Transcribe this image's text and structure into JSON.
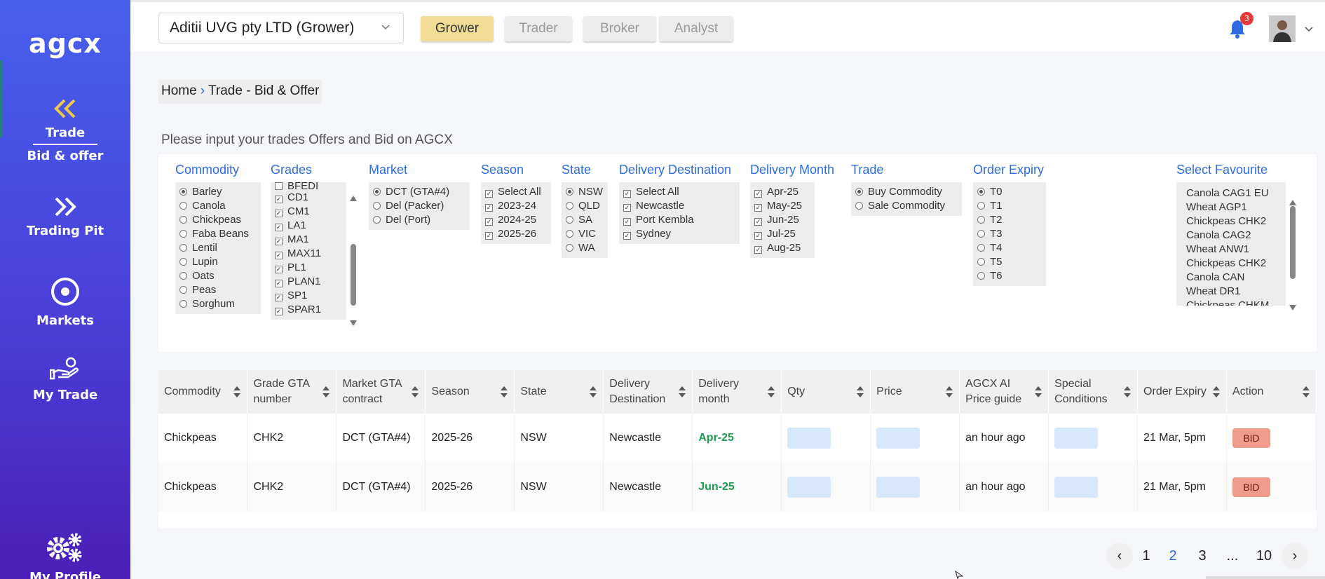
{
  "sidebar": {
    "logo": "agcx",
    "items": [
      {
        "label": "Trade",
        "sublabel": "Bid & offer",
        "icon": "double-chevron-left-icon"
      },
      {
        "label": "Trading Pit",
        "icon": "double-chevron-right-icon"
      },
      {
        "label": "Markets",
        "icon": "target-icon"
      },
      {
        "label": "My Trade",
        "icon": "hand-coin-icon"
      },
      {
        "label": "My Profile",
        "icon": "gears-icon"
      }
    ]
  },
  "header": {
    "company": "Aditii UVG pty LTD (Grower)",
    "roles": [
      "Grower",
      "Trader",
      "Broker",
      "Analyst"
    ],
    "active_role": "Grower",
    "notification_count": "3"
  },
  "breadcrumb": {
    "home": "Home",
    "current": "Trade - Bid & Offer"
  },
  "intro": "Please input your trades Offers and Bid on AGCX",
  "filters": {
    "commodity": {
      "title": "Commodity",
      "options": [
        "Barley",
        "Canola",
        "Chickpeas",
        "Faba Beans",
        "Lentil",
        "Lupin",
        "Oats",
        "Peas",
        "Sorghum"
      ],
      "selected": "Barley"
    },
    "grades": {
      "title": "Grades",
      "partial": "BFEDI",
      "options": [
        "CD1",
        "CM1",
        "LA1",
        "MA1",
        "MAX11",
        "PL1",
        "PLAN1",
        "SP1",
        "SPAR1"
      ]
    },
    "market": {
      "title": "Market",
      "options": [
        "DCT (GTA#4)",
        "Del (Packer)",
        "Del (Port)"
      ],
      "selected": "DCT (GTA#4)"
    },
    "season": {
      "title": "Season",
      "options": [
        "Select All",
        "2023-24",
        "2024-25",
        "2025-26"
      ]
    },
    "state": {
      "title": "State",
      "options": [
        "NSW",
        "QLD",
        "SA",
        "VIC",
        "WA"
      ],
      "selected": "NSW"
    },
    "delivery_destination": {
      "title": "Delivery Destination",
      "options": [
        "Select All",
        "Newcastle",
        "Port Kembla",
        "Sydney"
      ]
    },
    "delivery_month": {
      "title": "Delivery Month",
      "options": [
        "Apr-25",
        "May-25",
        "Jun-25",
        "Jul-25",
        "Aug-25"
      ]
    },
    "trade": {
      "title": "Trade",
      "options": [
        "Buy Commodity",
        "Sale Commodity"
      ],
      "selected": "Buy Commodity"
    },
    "order_expiry": {
      "title": "Order Expiry",
      "options": [
        "T0",
        "T1",
        "T2",
        "T3",
        "T4",
        "T5",
        "T6"
      ],
      "selected": "T0"
    },
    "favourite": {
      "title": "Select Favourite",
      "options": [
        "Canola CAG1 EU",
        "Wheat AGP1",
        "Chickpeas CHK2",
        "Canola CAG2",
        "Wheat ANW1",
        "Chickpeas CHK2",
        "Canola CAN",
        "Wheat DR1"
      ],
      "partial": "Chickpeas CHKM"
    }
  },
  "table": {
    "columns": [
      "Commodity",
      "Grade GTA number",
      "Market GTA contract",
      "Season",
      "State",
      "Delivery Destination",
      "Delivery month",
      "Qty",
      "Price",
      "AGCX AI Price guide",
      "Special Conditions",
      "Order Expiry",
      "Action"
    ],
    "rows": [
      {
        "commodity": "Chickpeas",
        "grade": "CHK2",
        "market": "DCT (GTA#4)",
        "season": "2025-26",
        "state": "NSW",
        "destination": "Newcastle",
        "month": "Apr-25",
        "price_guide": "an hour ago",
        "expiry": "21 Mar, 5pm",
        "action": "BID"
      },
      {
        "commodity": "Chickpeas",
        "grade": "CHK2",
        "market": "DCT (GTA#4)",
        "season": "2025-26",
        "state": "NSW",
        "destination": "Newcastle",
        "month": "Jun-25",
        "price_guide": "an hour ago",
        "expiry": "21 Mar, 5pm",
        "action": "BID"
      }
    ]
  },
  "pagination": {
    "prev": "‹",
    "pages": [
      "1",
      "2",
      "3",
      "...",
      "10"
    ],
    "current": "2",
    "next": "›"
  }
}
